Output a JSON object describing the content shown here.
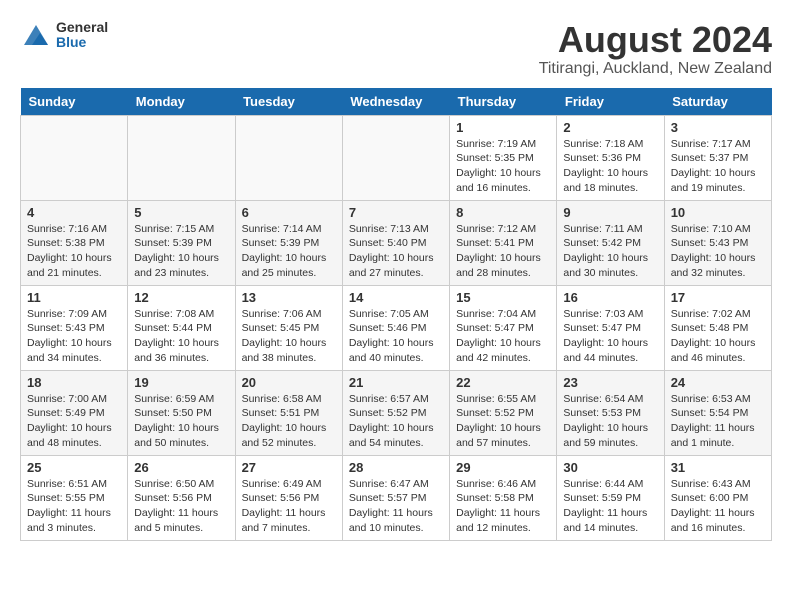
{
  "logo": {
    "general": "General",
    "blue": "Blue"
  },
  "header": {
    "month": "August 2024",
    "location": "Titirangi, Auckland, New Zealand"
  },
  "days_of_week": [
    "Sunday",
    "Monday",
    "Tuesday",
    "Wednesday",
    "Thursday",
    "Friday",
    "Saturday"
  ],
  "weeks": [
    [
      {
        "day": "",
        "info": ""
      },
      {
        "day": "",
        "info": ""
      },
      {
        "day": "",
        "info": ""
      },
      {
        "day": "",
        "info": ""
      },
      {
        "day": "1",
        "info": "Sunrise: 7:19 AM\nSunset: 5:35 PM\nDaylight: 10 hours\nand 16 minutes."
      },
      {
        "day": "2",
        "info": "Sunrise: 7:18 AM\nSunset: 5:36 PM\nDaylight: 10 hours\nand 18 minutes."
      },
      {
        "day": "3",
        "info": "Sunrise: 7:17 AM\nSunset: 5:37 PM\nDaylight: 10 hours\nand 19 minutes."
      }
    ],
    [
      {
        "day": "4",
        "info": "Sunrise: 7:16 AM\nSunset: 5:38 PM\nDaylight: 10 hours\nand 21 minutes."
      },
      {
        "day": "5",
        "info": "Sunrise: 7:15 AM\nSunset: 5:39 PM\nDaylight: 10 hours\nand 23 minutes."
      },
      {
        "day": "6",
        "info": "Sunrise: 7:14 AM\nSunset: 5:39 PM\nDaylight: 10 hours\nand 25 minutes."
      },
      {
        "day": "7",
        "info": "Sunrise: 7:13 AM\nSunset: 5:40 PM\nDaylight: 10 hours\nand 27 minutes."
      },
      {
        "day": "8",
        "info": "Sunrise: 7:12 AM\nSunset: 5:41 PM\nDaylight: 10 hours\nand 28 minutes."
      },
      {
        "day": "9",
        "info": "Sunrise: 7:11 AM\nSunset: 5:42 PM\nDaylight: 10 hours\nand 30 minutes."
      },
      {
        "day": "10",
        "info": "Sunrise: 7:10 AM\nSunset: 5:43 PM\nDaylight: 10 hours\nand 32 minutes."
      }
    ],
    [
      {
        "day": "11",
        "info": "Sunrise: 7:09 AM\nSunset: 5:43 PM\nDaylight: 10 hours\nand 34 minutes."
      },
      {
        "day": "12",
        "info": "Sunrise: 7:08 AM\nSunset: 5:44 PM\nDaylight: 10 hours\nand 36 minutes."
      },
      {
        "day": "13",
        "info": "Sunrise: 7:06 AM\nSunset: 5:45 PM\nDaylight: 10 hours\nand 38 minutes."
      },
      {
        "day": "14",
        "info": "Sunrise: 7:05 AM\nSunset: 5:46 PM\nDaylight: 10 hours\nand 40 minutes."
      },
      {
        "day": "15",
        "info": "Sunrise: 7:04 AM\nSunset: 5:47 PM\nDaylight: 10 hours\nand 42 minutes."
      },
      {
        "day": "16",
        "info": "Sunrise: 7:03 AM\nSunset: 5:47 PM\nDaylight: 10 hours\nand 44 minutes."
      },
      {
        "day": "17",
        "info": "Sunrise: 7:02 AM\nSunset: 5:48 PM\nDaylight: 10 hours\nand 46 minutes."
      }
    ],
    [
      {
        "day": "18",
        "info": "Sunrise: 7:00 AM\nSunset: 5:49 PM\nDaylight: 10 hours\nand 48 minutes."
      },
      {
        "day": "19",
        "info": "Sunrise: 6:59 AM\nSunset: 5:50 PM\nDaylight: 10 hours\nand 50 minutes."
      },
      {
        "day": "20",
        "info": "Sunrise: 6:58 AM\nSunset: 5:51 PM\nDaylight: 10 hours\nand 52 minutes."
      },
      {
        "day": "21",
        "info": "Sunrise: 6:57 AM\nSunset: 5:52 PM\nDaylight: 10 hours\nand 54 minutes."
      },
      {
        "day": "22",
        "info": "Sunrise: 6:55 AM\nSunset: 5:52 PM\nDaylight: 10 hours\nand 57 minutes."
      },
      {
        "day": "23",
        "info": "Sunrise: 6:54 AM\nSunset: 5:53 PM\nDaylight: 10 hours\nand 59 minutes."
      },
      {
        "day": "24",
        "info": "Sunrise: 6:53 AM\nSunset: 5:54 PM\nDaylight: 11 hours\nand 1 minute."
      }
    ],
    [
      {
        "day": "25",
        "info": "Sunrise: 6:51 AM\nSunset: 5:55 PM\nDaylight: 11 hours\nand 3 minutes."
      },
      {
        "day": "26",
        "info": "Sunrise: 6:50 AM\nSunset: 5:56 PM\nDaylight: 11 hours\nand 5 minutes."
      },
      {
        "day": "27",
        "info": "Sunrise: 6:49 AM\nSunset: 5:56 PM\nDaylight: 11 hours\nand 7 minutes."
      },
      {
        "day": "28",
        "info": "Sunrise: 6:47 AM\nSunset: 5:57 PM\nDaylight: 11 hours\nand 10 minutes."
      },
      {
        "day": "29",
        "info": "Sunrise: 6:46 AM\nSunset: 5:58 PM\nDaylight: 11 hours\nand 12 minutes."
      },
      {
        "day": "30",
        "info": "Sunrise: 6:44 AM\nSunset: 5:59 PM\nDaylight: 11 hours\nand 14 minutes."
      },
      {
        "day": "31",
        "info": "Sunrise: 6:43 AM\nSunset: 6:00 PM\nDaylight: 11 hours\nand 16 minutes."
      }
    ]
  ]
}
